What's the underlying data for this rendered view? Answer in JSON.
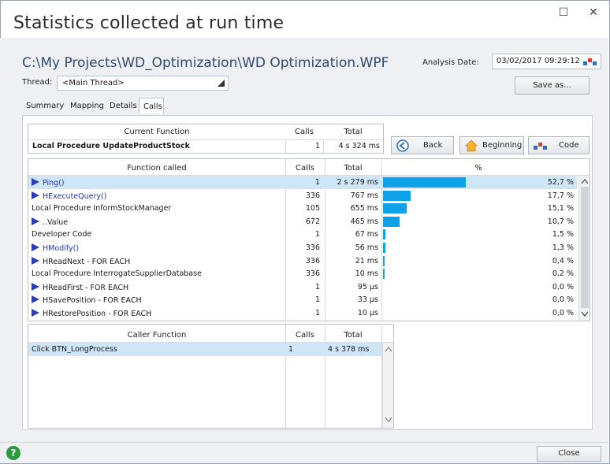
{
  "window": {
    "title": "Statistics collected at run time",
    "max_glyph": "☐",
    "close_glyph": "✕"
  },
  "project_path": "C:\\My Projects\\WD_Optimization\\WD Optimization.WPF",
  "analysis": {
    "label": "Analysis Date:",
    "value": "03/02/2017 09:29:12"
  },
  "thread": {
    "label": "Thread:",
    "value": "<Main Thread>"
  },
  "buttons": {
    "save_as": "Save as...",
    "back": "Back",
    "beginning": "Beginning",
    "code": "Code",
    "close": "Close"
  },
  "tabs": [
    "Summary",
    "Mapping",
    "Details",
    "Calls"
  ],
  "current_function": {
    "headers": [
      "Current Function",
      "Calls",
      "Total"
    ],
    "name": "Local Procedure UpdateProductStock",
    "calls": "1",
    "total": "4 s 324 ms"
  },
  "called": {
    "headers": [
      "Function called",
      "Calls",
      "Total",
      "%"
    ],
    "rows": [
      {
        "name": "Ping()",
        "calls": "1",
        "total": "2 s 279 ms",
        "pct": "52,7 %",
        "frac": 0.527,
        "icon": true,
        "blue": true
      },
      {
        "name": "HExecuteQuery()",
        "calls": "336",
        "total": "767 ms",
        "pct": "17,7 %",
        "frac": 0.177,
        "icon": true,
        "blue": true
      },
      {
        "name": "Local Procedure InformStockManager",
        "calls": "105",
        "total": "655 ms",
        "pct": "15,1 %",
        "frac": 0.151,
        "icon": false,
        "blue": false
      },
      {
        "name": "..Value",
        "calls": "672",
        "total": "465 ms",
        "pct": "10,7 %",
        "frac": 0.107,
        "icon": true,
        "blue": false
      },
      {
        "name": "Developer Code",
        "calls": "1",
        "total": "67 ms",
        "pct": "1,5 %",
        "frac": 0.015,
        "icon": false,
        "blue": false
      },
      {
        "name": "HModify()",
        "calls": "336",
        "total": "56 ms",
        "pct": "1,3 %",
        "frac": 0.013,
        "icon": true,
        "blue": true
      },
      {
        "name": "HReadNext - FOR EACH",
        "calls": "336",
        "total": "21 ms",
        "pct": "0,4 %",
        "frac": 0.004,
        "icon": true,
        "blue": false
      },
      {
        "name": "Local Procedure InterrogateSupplierDatabase",
        "calls": "336",
        "total": "10 ms",
        "pct": "0,2 %",
        "frac": 0.002,
        "icon": false,
        "blue": false
      },
      {
        "name": "HReadFirst - FOR EACH",
        "calls": "1",
        "total": "95 µs",
        "pct": "0,0 %",
        "frac": 0.0,
        "icon": true,
        "blue": false
      },
      {
        "name": "HSavePosition - FOR EACH",
        "calls": "1",
        "total": "33 µs",
        "pct": "0,0 %",
        "frac": 0.0,
        "icon": true,
        "blue": false
      },
      {
        "name": "HRestorePosition - FOR EACH",
        "calls": "1",
        "total": "10 µs",
        "pct": "0,0 %",
        "frac": 0.0,
        "icon": true,
        "blue": false
      }
    ]
  },
  "caller": {
    "headers": [
      "Caller Function",
      "Calls",
      "Total"
    ],
    "rows": [
      {
        "name": "Click BTN_LongProcess",
        "calls": "1",
        "total": "4 s 378 ms"
      }
    ]
  },
  "colors": {
    "accent_bar": "#0fa2e8",
    "selection": "#cfe6f6",
    "link_blue": "#2332b9"
  }
}
